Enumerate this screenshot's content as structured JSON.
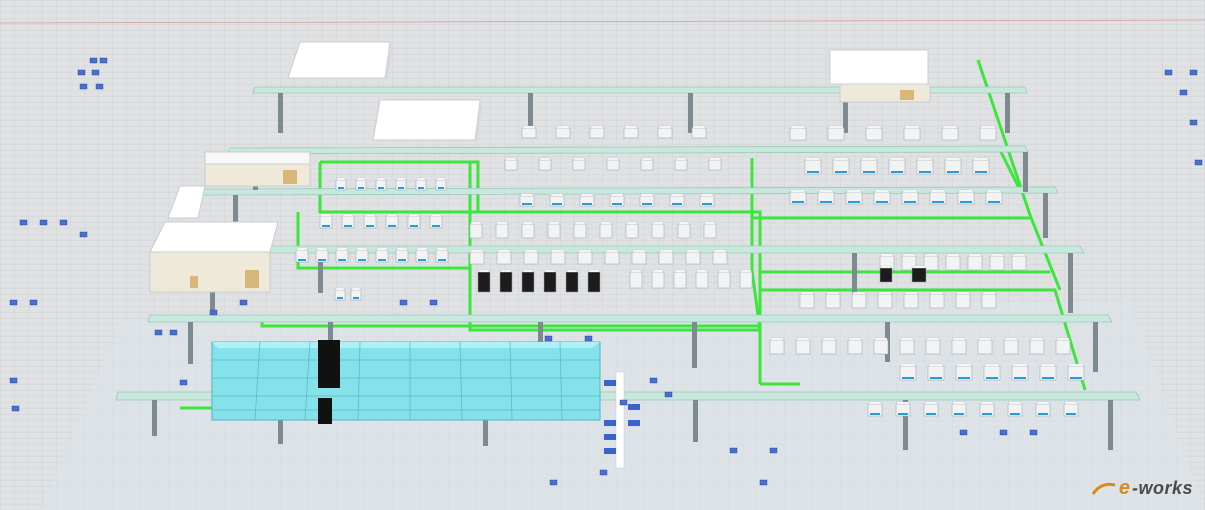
{
  "scene": {
    "description_kind": "3d-factory-layout-render",
    "floor_color": "#dfe1e3",
    "grid_color": "#c8cbce",
    "conveyor_color": "#39e639",
    "gantry_color": "#c8e6dc",
    "pillar_color": "#7c8a8f",
    "building_color": "#ffffff",
    "glass_color": "#7fe0ea",
    "machine_color": "#f2f3f4",
    "machine_accent": "#2a9bd8",
    "dark_machine_color": "#1c1c1c"
  },
  "watermark": {
    "logo_letter": "e",
    "logo_rest": "-works",
    "accent_color": "#d98a1c",
    "text_color": "#4b4b4b"
  }
}
